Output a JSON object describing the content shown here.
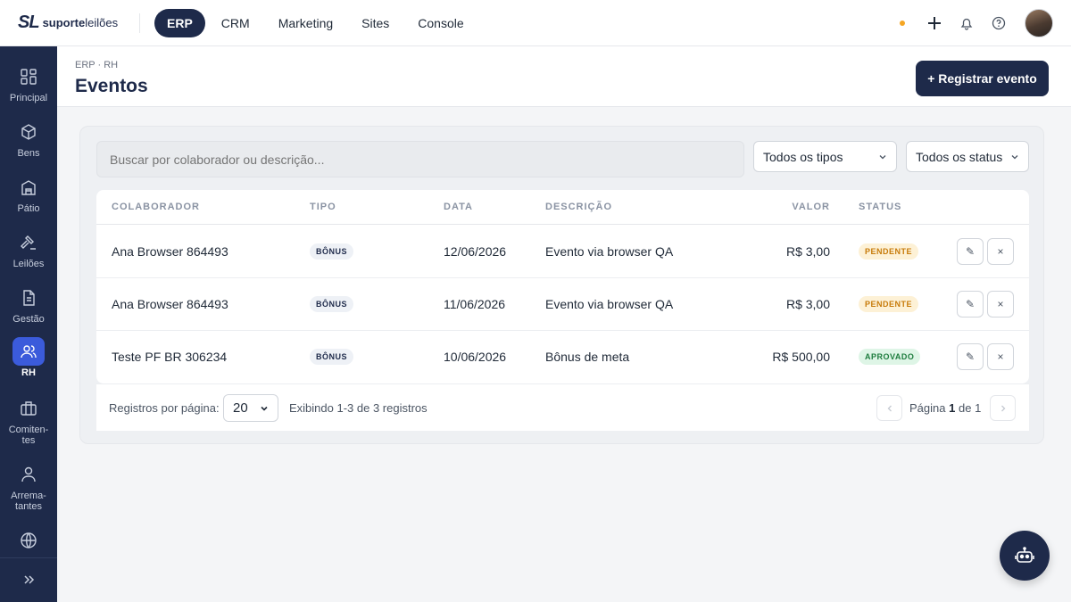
{
  "brand": {
    "mark": "SL",
    "name_bold": "suporte",
    "name_light": "leilões"
  },
  "topnav": [
    {
      "label": "ERP",
      "active": true
    },
    {
      "label": "CRM",
      "active": false
    },
    {
      "label": "Marketing",
      "active": false
    },
    {
      "label": "Sites",
      "active": false
    },
    {
      "label": "Console",
      "active": false
    }
  ],
  "sidebar": {
    "items": [
      {
        "label": "Principal",
        "icon": "grid-icon"
      },
      {
        "label": "Bens",
        "icon": "box-icon"
      },
      {
        "label": "Pátio",
        "icon": "warehouse-icon"
      },
      {
        "label": "Leilões",
        "icon": "gavel-icon"
      },
      {
        "label": "Gestão",
        "icon": "document-icon"
      },
      {
        "label": "RH",
        "icon": "users-icon",
        "active": true
      },
      {
        "label": "Comiten-tes",
        "icon": "briefcase-icon"
      },
      {
        "label": "Arrema-tantes",
        "icon": "user-icon"
      }
    ]
  },
  "header": {
    "breadcrumb": "ERP · RH",
    "title": "Eventos",
    "primary_action": "+ Registrar evento"
  },
  "filters": {
    "search_placeholder": "Buscar por colaborador ou descrição...",
    "type_select": "Todos os tipos",
    "status_select": "Todos os status"
  },
  "table": {
    "columns": [
      "COLABORADOR",
      "TIPO",
      "DATA",
      "DESCRIÇÃO",
      "VALOR",
      "STATUS"
    ],
    "rows": [
      {
        "colaborador": "Ana Browser 864493",
        "tipo": "BÔNUS",
        "data": "12/06/2026",
        "descricao": "Evento via browser QA",
        "valor": "R$ 3,00",
        "status": "PENDENTE"
      },
      {
        "colaborador": "Ana Browser 864493",
        "tipo": "BÔNUS",
        "data": "11/06/2026",
        "descricao": "Evento via browser QA",
        "valor": "R$ 3,00",
        "status": "PENDENTE"
      },
      {
        "colaborador": "Teste PF BR 306234",
        "tipo": "BÔNUS",
        "data": "10/06/2026",
        "descricao": "Bônus de meta",
        "valor": "R$ 500,00",
        "status": "APROVADO"
      }
    ],
    "edit_glyph": "✎",
    "delete_glyph": "×"
  },
  "pagination": {
    "per_page_label": "Registros por página:",
    "per_page_value": "20",
    "info": "Exibindo 1-3 de 3 registros",
    "page_prefix": "Página",
    "page_current": "1",
    "page_sep": "de",
    "page_total": "1"
  },
  "colors": {
    "navy": "#1e2a4a",
    "accent_blue": "#3b5bdb",
    "pending_bg": "#fdf1d6",
    "approved_bg": "#def5e6",
    "notice_dot": "#f5a623"
  }
}
